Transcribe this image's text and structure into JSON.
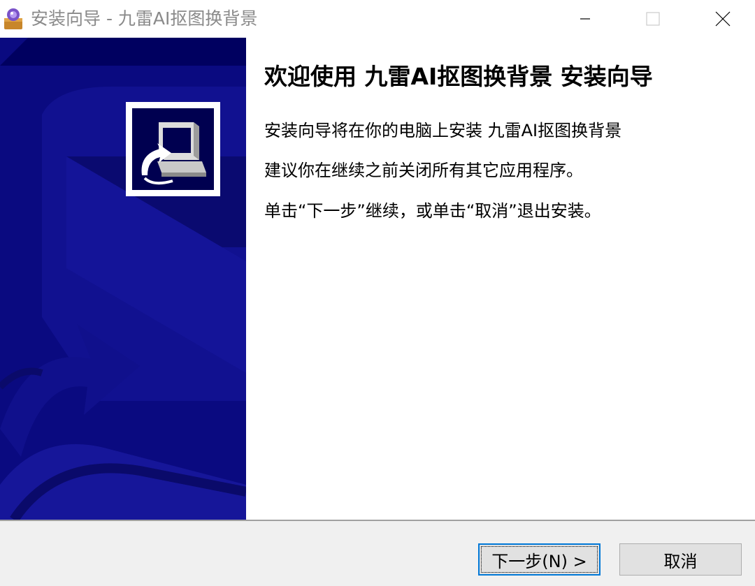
{
  "window": {
    "title": "安装向导 - 九雷AI抠图换背景",
    "controls": {
      "minimize_icon": "minimize-icon",
      "maximize_icon": "maximize-icon",
      "close_icon": "close-icon"
    }
  },
  "banner": {
    "background_color": "#0a0a80",
    "logo_icon": "installer-computer-icon"
  },
  "content": {
    "heading": "欢迎使用 九雷AI抠图换背景 安装向导",
    "paragraphs": [
      "安装向导将在你的电脑上安装 九雷AI抠图换背景",
      "建议你在继续之前关闭所有其它应用程序。",
      "单击“下一步”继续，或单击“取消”退出安装。"
    ]
  },
  "footer": {
    "next_label": "下一步(N) >",
    "cancel_label": "取消"
  },
  "colors": {
    "accent": "#0078d7",
    "footer_bg": "#f0f0f0"
  }
}
